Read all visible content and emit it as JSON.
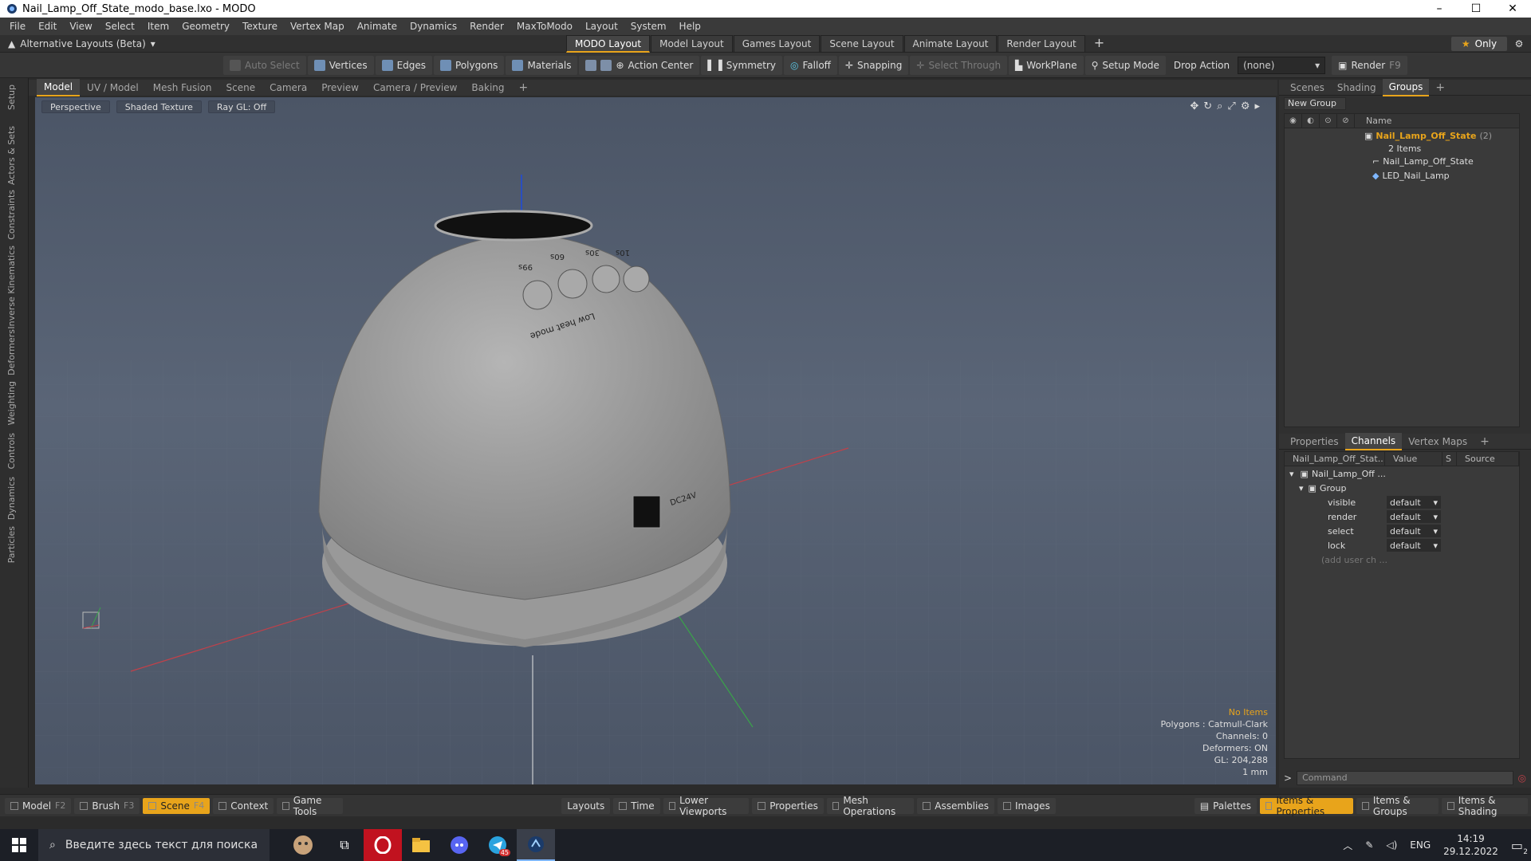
{
  "window": {
    "title": "Nail_Lamp_Off_State_modo_base.lxo - MODO",
    "minimize": "–",
    "maximize": "☐",
    "close": "✕"
  },
  "menu": [
    "File",
    "Edit",
    "View",
    "Select",
    "Item",
    "Geometry",
    "Texture",
    "Vertex Map",
    "Animate",
    "Dynamics",
    "Render",
    "MaxToModo",
    "Layout",
    "System",
    "Help"
  ],
  "layouts": {
    "alt_label": "Alternative Layouts (Beta)",
    "tabs": [
      "MODO Layout",
      "Model Layout",
      "Games Layout",
      "Scene Layout",
      "Animate Layout",
      "Render Layout"
    ],
    "active": "MODO Layout",
    "only_label": "Only"
  },
  "toolbar": {
    "auto_select": "Auto Select",
    "vertices": "Vertices",
    "edges": "Edges",
    "polygons": "Polygons",
    "materials": "Materials",
    "action_center": "Action Center",
    "symmetry": "Symmetry",
    "falloff": "Falloff",
    "snapping": "Snapping",
    "select_through": "Select Through",
    "workplane": "WorkPlane",
    "setup_mode": "Setup Mode",
    "drop_action": "Drop Action",
    "drop_value": "(none)",
    "render": "Render",
    "render_key": "F9"
  },
  "left_strip": [
    "Setup",
    "Actors & Sets",
    "Constraints",
    "Inverse Kinematics",
    "Deformers",
    "Weighting",
    "Controls",
    "Dynamics",
    "Particles"
  ],
  "viewport_tabs": [
    "Model",
    "UV / Model",
    "Mesh Fusion",
    "Scene",
    "Camera",
    "Preview",
    "Camera / Preview",
    "Baking"
  ],
  "viewport": {
    "view": "Perspective",
    "shading": "Shaded Texture",
    "raygl": "Ray GL: Off",
    "model_labels": {
      "b1": "99s",
      "b2": "60s",
      "b3": "30s",
      "b4": "10s",
      "mode": "Low heat mode",
      "dc": "DC24V"
    },
    "stats": {
      "no_items": "No Items",
      "polygons": "Polygons : Catmull-Clark",
      "channels": "Channels: 0",
      "deformers": "Deformers: ON",
      "gl": "GL: 204,288",
      "unit": "1 mm"
    }
  },
  "top_panel": {
    "tabs": [
      "Scenes",
      "Shading",
      "Groups"
    ],
    "active": "Groups",
    "new_group": "New Group",
    "name_header": "Name",
    "group": {
      "name": "Nail_Lamp_Off_State",
      "count": "(2)",
      "items_label": "2 Items"
    },
    "children": [
      "Nail_Lamp_Off_State",
      "LED_Nail_Lamp"
    ]
  },
  "bottom_panel": {
    "tabs": [
      "Properties",
      "Channels",
      "Vertex Maps"
    ],
    "active": "Channels",
    "headers": [
      "Nail_Lamp_Off_Stat...",
      "Value",
      "S",
      "Source"
    ],
    "root": "Nail_Lamp_Off ...",
    "group": "Group",
    "channels": [
      {
        "name": "visible",
        "value": "default"
      },
      {
        "name": "render",
        "value": "default"
      },
      {
        "name": "select",
        "value": "default"
      },
      {
        "name": "lock",
        "value": "default"
      }
    ],
    "add_user": "(add user ch ...",
    "command_placeholder": "Command"
  },
  "bottombar": {
    "left": [
      {
        "label": "Model",
        "key": "F2"
      },
      {
        "label": "Brush",
        "key": "F3"
      },
      {
        "label": "Scene",
        "key": "F4"
      },
      {
        "label": "Context",
        "key": ""
      },
      {
        "label": "Game Tools",
        "key": ""
      }
    ],
    "middle": [
      "Layouts",
      "Time",
      "Lower Viewports",
      "Properties",
      "Mesh Operations",
      "Assemblies",
      "Images"
    ],
    "right": [
      "Palettes",
      "Items & Properties",
      "Items & Groups",
      "Items & Shading"
    ]
  },
  "taskbar": {
    "search_placeholder": "Введите здесь текст для поиска",
    "lang": "ENG",
    "time": "14:19",
    "date": "29.12.2022",
    "notif_count": "2",
    "telegram_badge": "45"
  },
  "colors": {
    "accent": "#e8a41b",
    "viewport": "#525d6e",
    "panel": "#303030"
  }
}
